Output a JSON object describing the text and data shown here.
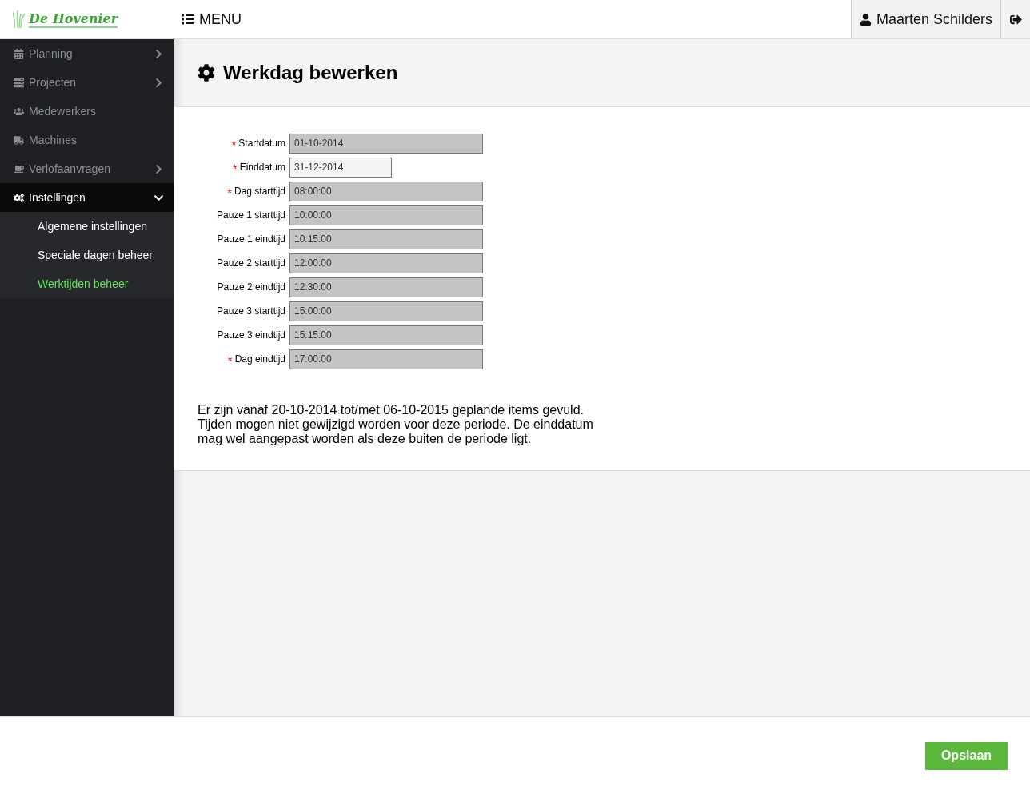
{
  "logo": {
    "text": "De Hovenier"
  },
  "menu_button": {
    "label": "MENU"
  },
  "user": {
    "name": "Maarten Schilders"
  },
  "sidebar": {
    "items": [
      {
        "kind": "calendar",
        "label": "Planning",
        "has_submenu": true,
        "expanded": false
      },
      {
        "kind": "projects",
        "label": "Projecten",
        "has_submenu": true,
        "expanded": false
      },
      {
        "kind": "users",
        "label": "Medewerkers",
        "has_submenu": false,
        "expanded": false
      },
      {
        "kind": "truck",
        "label": "Machines",
        "has_submenu": false,
        "expanded": false
      },
      {
        "kind": "coffee",
        "label": "Verlofaanvragen",
        "has_submenu": true,
        "expanded": false
      },
      {
        "kind": "cogs",
        "label": "Instellingen",
        "has_submenu": true,
        "expanded": true,
        "children": [
          {
            "label": "Algemene instellingen",
            "selected": false
          },
          {
            "label": "Speciale dagen beheer",
            "selected": false
          },
          {
            "label": "Werktijden beheer",
            "selected": true
          }
        ]
      }
    ]
  },
  "page_title": "Werkdag bewerken",
  "form": {
    "fields": [
      {
        "label": "Startdatum",
        "value": "01-10-2014",
        "required": true,
        "disabled": true
      },
      {
        "label": "Einddatum",
        "value": "31-12-2014",
        "required": true,
        "disabled": false
      },
      {
        "label": "Dag starttijd",
        "value": "08:00:00",
        "required": true,
        "disabled": true
      },
      {
        "label": "Pauze 1 starttijd",
        "value": "10:00:00",
        "required": false,
        "disabled": true
      },
      {
        "label": "Pauze 1 eindtijd",
        "value": "10:15:00",
        "required": false,
        "disabled": true
      },
      {
        "label": "Pauze 2 starttijd",
        "value": "12:00:00",
        "required": false,
        "disabled": true
      },
      {
        "label": "Pauze 2 eindtijd",
        "value": "12:30:00",
        "required": false,
        "disabled": true
      },
      {
        "label": "Pauze 3 starttijd",
        "value": "15:00:00",
        "required": false,
        "disabled": true
      },
      {
        "label": "Pauze 3 eindtijd",
        "value": "15:15:00",
        "required": false,
        "disabled": true
      },
      {
        "label": "Dag eindtijd",
        "value": "17:00:00",
        "required": true,
        "disabled": true
      }
    ],
    "required_mark": "*",
    "notice": "Er zijn vanaf 20-10-2014 tot/met 06-10-2015 geplande items gevuld. Tijden mogen niet gewijzigd worden voor deze periode. De einddatum mag wel aangepast worden als deze buiten de periode ligt."
  },
  "save_button": {
    "label": "Opslaan"
  }
}
